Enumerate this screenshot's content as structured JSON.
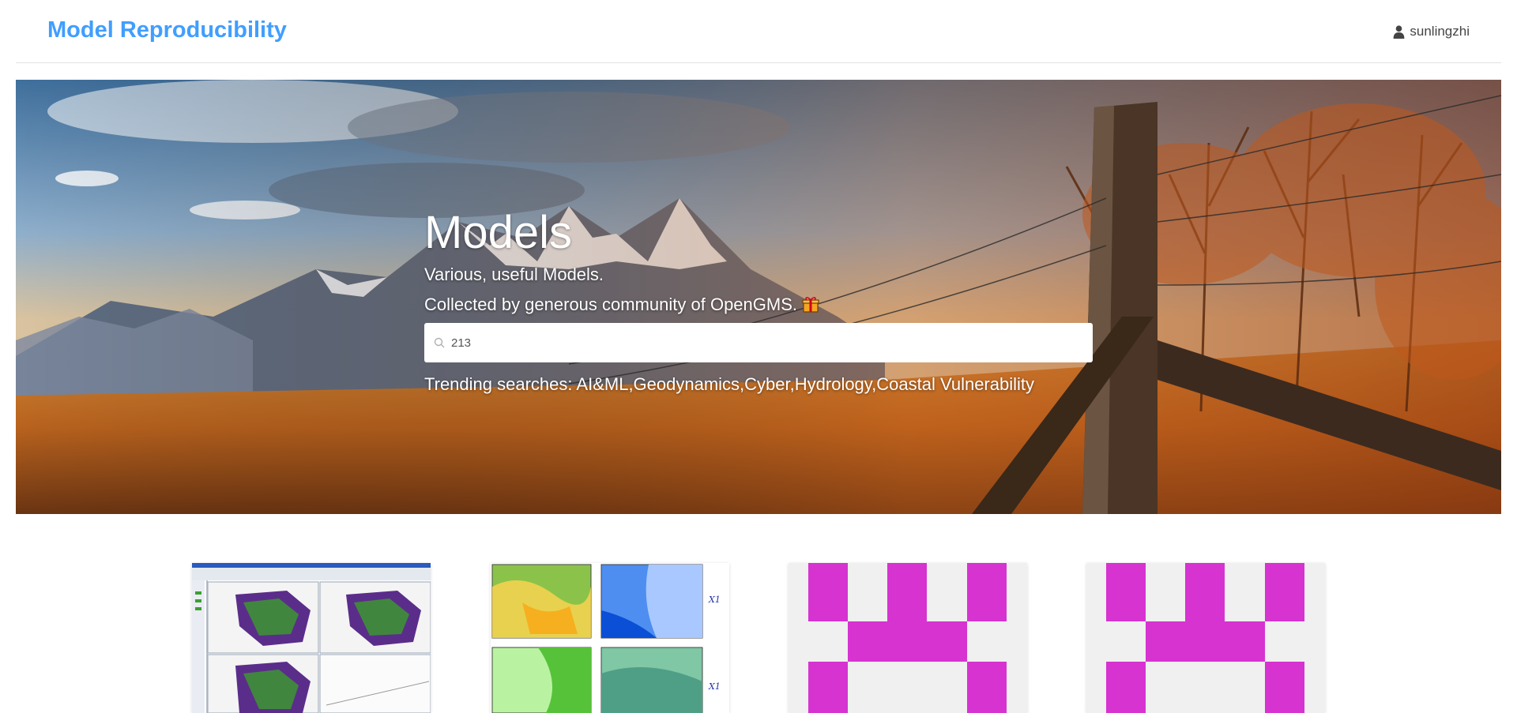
{
  "header": {
    "brand": "Model Reproducibility",
    "username": "sunlingzhi"
  },
  "hero": {
    "title": "Models",
    "subtitle": "Various, useful Models.",
    "tagline": "Collected by generous community of OpenGMS.",
    "search_value": "213",
    "trending_label": "Trending searches:",
    "trending_items": "AI&ML,Geodynamics,Cyber,Hydrology,Coastal Vulnerability"
  },
  "cards": [
    {
      "thumbnail": "gis-software-screenshot"
    },
    {
      "thumbnail": "map-panels"
    },
    {
      "thumbnail": "default-pattern"
    },
    {
      "thumbnail": "default-pattern"
    }
  ],
  "colors": {
    "brand": "#409eff",
    "pattern": "#d633d1",
    "pattern_bg": "#f0f0f0"
  }
}
